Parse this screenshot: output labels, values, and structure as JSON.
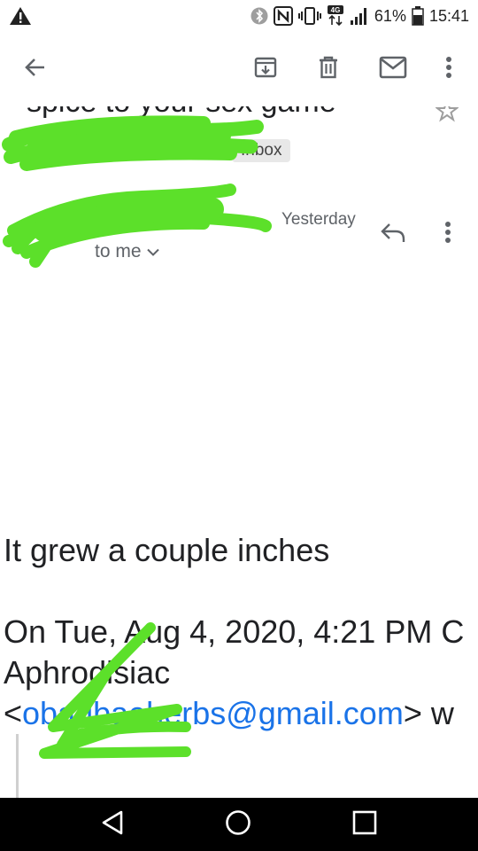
{
  "status_bar": {
    "battery_percent": "61%",
    "time": "15:41",
    "network_badge": "4G",
    "icons": [
      "warning-icon",
      "bluetooth-icon",
      "nfc-icon",
      "vibrate-icon",
      "data-arrows-icon",
      "signal-icon",
      "battery-icon"
    ]
  },
  "toolbar": {
    "icons": [
      "back-arrow-icon",
      "archive-icon",
      "delete-icon",
      "mark-unread-icon",
      "more-vert-icon"
    ]
  },
  "email": {
    "subject": "spice to your sex game",
    "label": "Inbox",
    "date": "Yesterday",
    "recipient": "to me",
    "body_line": "It grew a couple inches",
    "quote_header_1": "On Tue, Aug 4, 2020, 4:21 PM",
    "quote_header_1_tail": "C",
    "quote_header_2": "Aphrodisiac",
    "quote_email_open": "<",
    "quote_email": "obadbaeherbs@gmail.com",
    "quote_email_close": "> w"
  },
  "colors": {
    "accent_link": "#1a73e8",
    "redaction": "#5ce02a",
    "nav_bar": "#000000"
  }
}
